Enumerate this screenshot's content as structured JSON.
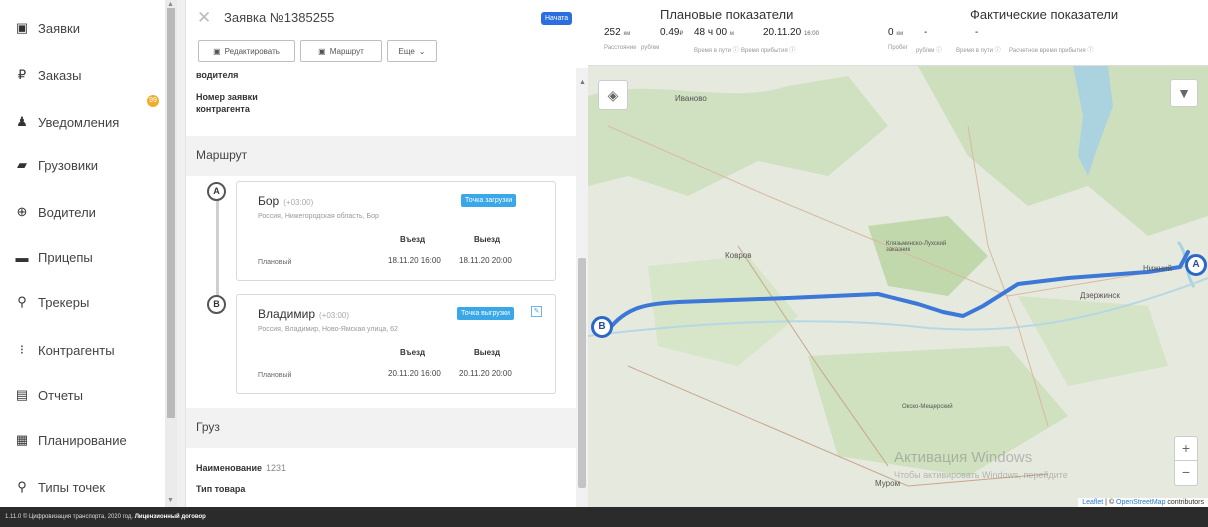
{
  "sidebar": {
    "items": [
      {
        "label": "Заявки",
        "icon": "document-icon",
        "glyph": "▣"
      },
      {
        "label": "Заказы",
        "icon": "ruble-icon",
        "glyph": "₽"
      },
      {
        "label": "Уведомления",
        "icon": "bell-icon",
        "glyph": "♟"
      },
      {
        "label": "Грузовики",
        "icon": "truck-icon",
        "glyph": "▰"
      },
      {
        "label": "Водители",
        "icon": "steering-wheel-icon",
        "glyph": "⊕"
      },
      {
        "label": "Прицепы",
        "icon": "trailer-icon",
        "glyph": "▬"
      },
      {
        "label": "Трекеры",
        "icon": "location-pin-icon",
        "glyph": "⚲"
      },
      {
        "label": "Контрагенты",
        "icon": "contractor-icon",
        "glyph": "⁝"
      },
      {
        "label": "Отчеты",
        "icon": "report-icon",
        "glyph": "▤"
      },
      {
        "label": "Планирование",
        "icon": "calendar-icon",
        "glyph": "▦"
      },
      {
        "label": "Типы точек",
        "icon": "location-pin-icon",
        "glyph": "⚲"
      }
    ],
    "notifications_badge": "99"
  },
  "request": {
    "title": "Заявка №1385255",
    "status_badge": "Начата",
    "buttons": {
      "edit": "Редактировать",
      "route": "Маршрут",
      "more": "Еще"
    },
    "fields": {
      "driver_tail": "водителя",
      "contractor_number_line1": "Номер заявки",
      "contractor_number_line2": "контрагента"
    },
    "route_section": "Маршрут",
    "points": [
      {
        "marker": "A",
        "city": "Бор",
        "tz": "(+03:00)",
        "address": "Россия, Нижегородская область, Бор",
        "tag": "Точка загрузки",
        "entry_label": "Въезд",
        "exit_label": "Выезд",
        "plan_label": "Плановый",
        "entry": "18.11.20 16:00",
        "exit": "18.11.20 20:00"
      },
      {
        "marker": "B",
        "city": "Владимир",
        "tz": "(+03:00)",
        "address": "Россия, Владимир, Ново-Ямская улица, 62",
        "tag": "Точка выгрузки",
        "entry_label": "Въезд",
        "exit_label": "Выезд",
        "plan_label": "Плановый",
        "entry": "20.11.20 16:00",
        "exit": "20.11.20 20:00"
      }
    ],
    "cargo_section": "Груз",
    "cargo": {
      "name_label": "Наименование",
      "name_value": "1231",
      "type_label": "Тип товара"
    }
  },
  "stats": {
    "planned_title": "Плановые показатели",
    "actual_title": "Фактические показатели",
    "planned": [
      {
        "value": "252",
        "unit": "км",
        "label": "Расстояние"
      },
      {
        "value": "0.49",
        "unit": "₽",
        "label": "руб/км"
      },
      {
        "value": "48 ч 00",
        "unit": "м",
        "label": "Время в пути ⓘ"
      },
      {
        "value": "20.11.20",
        "unit": "16:00",
        "label": "Время прибытия ⓘ"
      }
    ],
    "actual": [
      {
        "value": "0",
        "unit": "км",
        "label": "Пробег"
      },
      {
        "value": "-",
        "unit": "",
        "label": "руб/км ⓘ"
      },
      {
        "value": "-",
        "unit": "",
        "label": "Время в пути ⓘ"
      },
      {
        "value": "",
        "unit": "",
        "label": "Расчетное время прибытия ⓘ"
      }
    ]
  },
  "map": {
    "labels": [
      "Иваново",
      "Ковров",
      "Клязьминско-Лухский заказник",
      "Нижний",
      "Дзержинск",
      "Окско-Мещерский",
      "Муром"
    ],
    "markers": {
      "start": "A",
      "end": "B"
    },
    "zoom_in": "+",
    "zoom_out": "−",
    "watermark_line1": "Активация Windows",
    "watermark_line2": "Чтобы активировать Windows, перейдите",
    "attribution_leaflet": "Leaflet",
    "attribution_sep": " | © ",
    "attribution_osm": "OpenStreetMap",
    "attribution_tail": " contributors",
    "colors": {
      "route": "#3b78d8",
      "water": "#aad3df",
      "forest": "#c8dcb6",
      "land": "#e8ebe1"
    }
  },
  "footer": {
    "text": "1.11.0 © Цифровизация транспорта, 2020 год.",
    "link": "Лицензионный договор"
  }
}
